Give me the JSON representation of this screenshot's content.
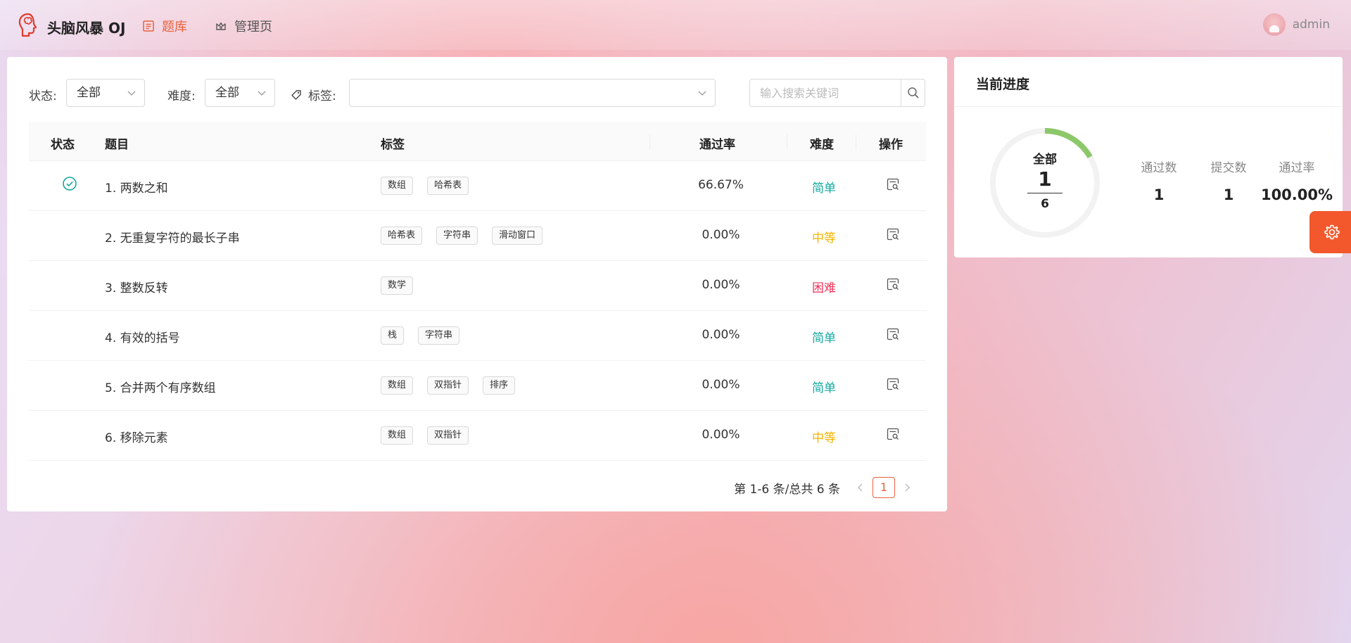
{
  "header": {
    "brand": "头脑风暴 OJ",
    "nav": [
      {
        "label": "题库",
        "icon": "list-icon",
        "active": true
      },
      {
        "label": "管理页",
        "icon": "crown-icon",
        "active": false
      }
    ],
    "user": {
      "name": "admin",
      "icon": "avatar"
    }
  },
  "filters": {
    "status_label": "状态:",
    "status_value": "全部",
    "difficulty_label": "难度:",
    "difficulty_value": "全部",
    "tags_label": "标签:",
    "tags_value": "",
    "search_placeholder": "输入搜索关键词"
  },
  "table": {
    "headers": {
      "status": "状态",
      "title": "题目",
      "tags": "标签",
      "rate": "通过率",
      "difficulty": "难度",
      "action": "操作"
    },
    "rows": [
      {
        "solved": true,
        "title": "1. 两数之和",
        "tags": [
          "数组",
          "哈希表"
        ],
        "rate": "66.67%",
        "difficulty": "简单",
        "difficulty_color": "#13a89e"
      },
      {
        "solved": false,
        "title": "2. 无重复字符的最长子串",
        "tags": [
          "哈希表",
          "字符串",
          "滑动窗口"
        ],
        "rate": "0.00%",
        "difficulty": "中等",
        "difficulty_color": "#f5b400"
      },
      {
        "solved": false,
        "title": "3. 整数反转",
        "tags": [
          "数学"
        ],
        "rate": "0.00%",
        "difficulty": "困难",
        "difficulty_color": "#f0345a"
      },
      {
        "solved": false,
        "title": "4. 有效的括号",
        "tags": [
          "栈",
          "字符串"
        ],
        "rate": "0.00%",
        "difficulty": "简单",
        "difficulty_color": "#13a89e"
      },
      {
        "solved": false,
        "title": "5. 合并两个有序数组",
        "tags": [
          "数组",
          "双指针",
          "排序"
        ],
        "rate": "0.00%",
        "difficulty": "简单",
        "difficulty_color": "#13a89e"
      },
      {
        "solved": false,
        "title": "6. 移除元素",
        "tags": [
          "数组",
          "双指针"
        ],
        "rate": "0.00%",
        "difficulty": "中等",
        "difficulty_color": "#f5b400"
      }
    ]
  },
  "pagination": {
    "summary": "第 1-6 条/总共 6 条",
    "current_page": "1"
  },
  "progress": {
    "title": "当前进度",
    "ring_label": "全部",
    "passed": "1",
    "total": "6",
    "passed_fraction": 0.1667,
    "stats": [
      {
        "label": "通过数",
        "value": "1"
      },
      {
        "label": "提交数",
        "value": "1"
      },
      {
        "label": "通过率",
        "value": "100.00%"
      }
    ],
    "ring_color": "#8cc86a",
    "track_color": "#f2f2f2"
  },
  "colors": {
    "accent": "#e8623c",
    "settings_button": "#f2582c"
  }
}
